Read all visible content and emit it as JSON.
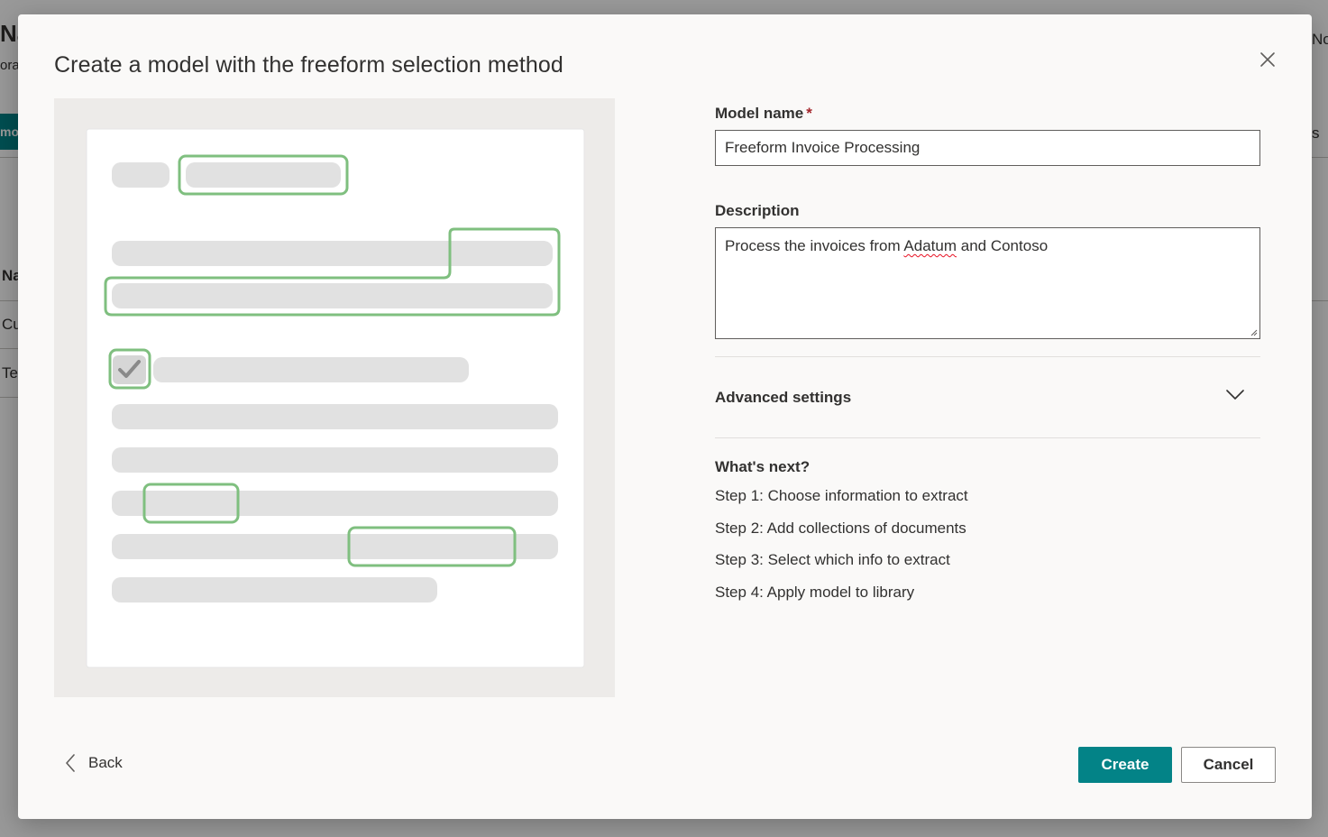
{
  "background": {
    "fragments": [
      "Na",
      "ora",
      "mo",
      "Na",
      "Cu",
      "Te",
      "No",
      "s"
    ]
  },
  "dialog": {
    "title": "Create a model with the freeform selection method",
    "close_icon": "close-icon"
  },
  "form": {
    "model_name_label": "Model name",
    "required_marker": "*",
    "model_name_value": "Freeform Invoice Processing",
    "description_label": "Description",
    "description_before": "Process the invoices from ",
    "description_misspelled": "Adatum",
    "description_after": " and Contoso",
    "advanced_settings_label": "Advanced settings",
    "whats_next_title": "What's next?",
    "steps": [
      "Step 1: Choose information to extract",
      "Step 2: Add collections of documents",
      "Step 3: Select which info to extract",
      "Step 4: Apply model to library"
    ]
  },
  "footer": {
    "back_label": "Back",
    "create_label": "Create",
    "cancel_label": "Cancel"
  },
  "colors": {
    "accent": "#038387",
    "selection_green": "#7fbf7f",
    "placeholder_bar": "#e1e1e1",
    "required": "#a4262c"
  }
}
